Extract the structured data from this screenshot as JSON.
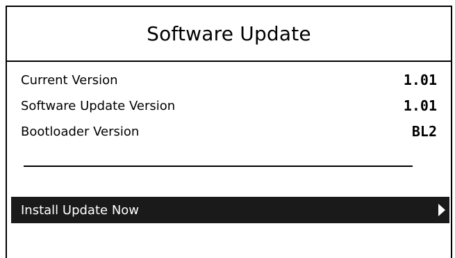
{
  "screen": {
    "title": "Software Update"
  },
  "info": [
    {
      "label": "Current Version",
      "value": "1.01"
    },
    {
      "label": "Software Update Version",
      "value": "1.01"
    },
    {
      "label": "Bootloader Version",
      "value": "BL2"
    }
  ],
  "menu": {
    "install_label": "Install Update Now",
    "arrow_icon": "triangle-right-icon"
  },
  "colors": {
    "background": "#ffffff",
    "foreground": "#000000",
    "selection": "#1a1a1a"
  }
}
